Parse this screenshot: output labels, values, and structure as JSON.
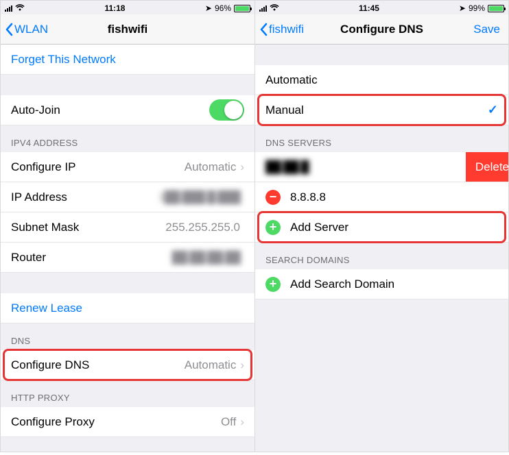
{
  "left": {
    "status": {
      "time": "11:18",
      "battery_pct": "96%"
    },
    "nav": {
      "back": "WLAN",
      "title": "fishwifi"
    },
    "forget": "Forget This Network",
    "auto_join": "Auto-Join",
    "ipv4_header": "IPV4 ADDRESS",
    "configure_ip": {
      "label": "Configure IP",
      "value": "Automatic"
    },
    "ip_address": {
      "label": "IP Address",
      "value": "1██.███.█.███"
    },
    "subnet": {
      "label": "Subnet Mask",
      "value": "255.255.255.0"
    },
    "router": {
      "label": "Router",
      "value": "██.██.██.██"
    },
    "renew": "Renew Lease",
    "dns_header": "DNS",
    "configure_dns": {
      "label": "Configure DNS",
      "value": "Automatic"
    },
    "proxy_header": "HTTP PROXY",
    "configure_proxy": {
      "label": "Configure Proxy",
      "value": "Off"
    }
  },
  "right": {
    "status": {
      "time": "11:45",
      "battery_pct": "99%"
    },
    "nav": {
      "back": "fishwifi",
      "title": "Configure DNS",
      "save": "Save"
    },
    "mode": {
      "automatic": "Automatic",
      "manual": "Manual"
    },
    "dns_servers_header": "DNS SERVERS",
    "servers": {
      "first": "██.██.█",
      "second": "8.8.8.8",
      "add": "Add Server",
      "delete": "Delete"
    },
    "search_header": "SEARCH DOMAINS",
    "add_search": "Add Search Domain"
  }
}
